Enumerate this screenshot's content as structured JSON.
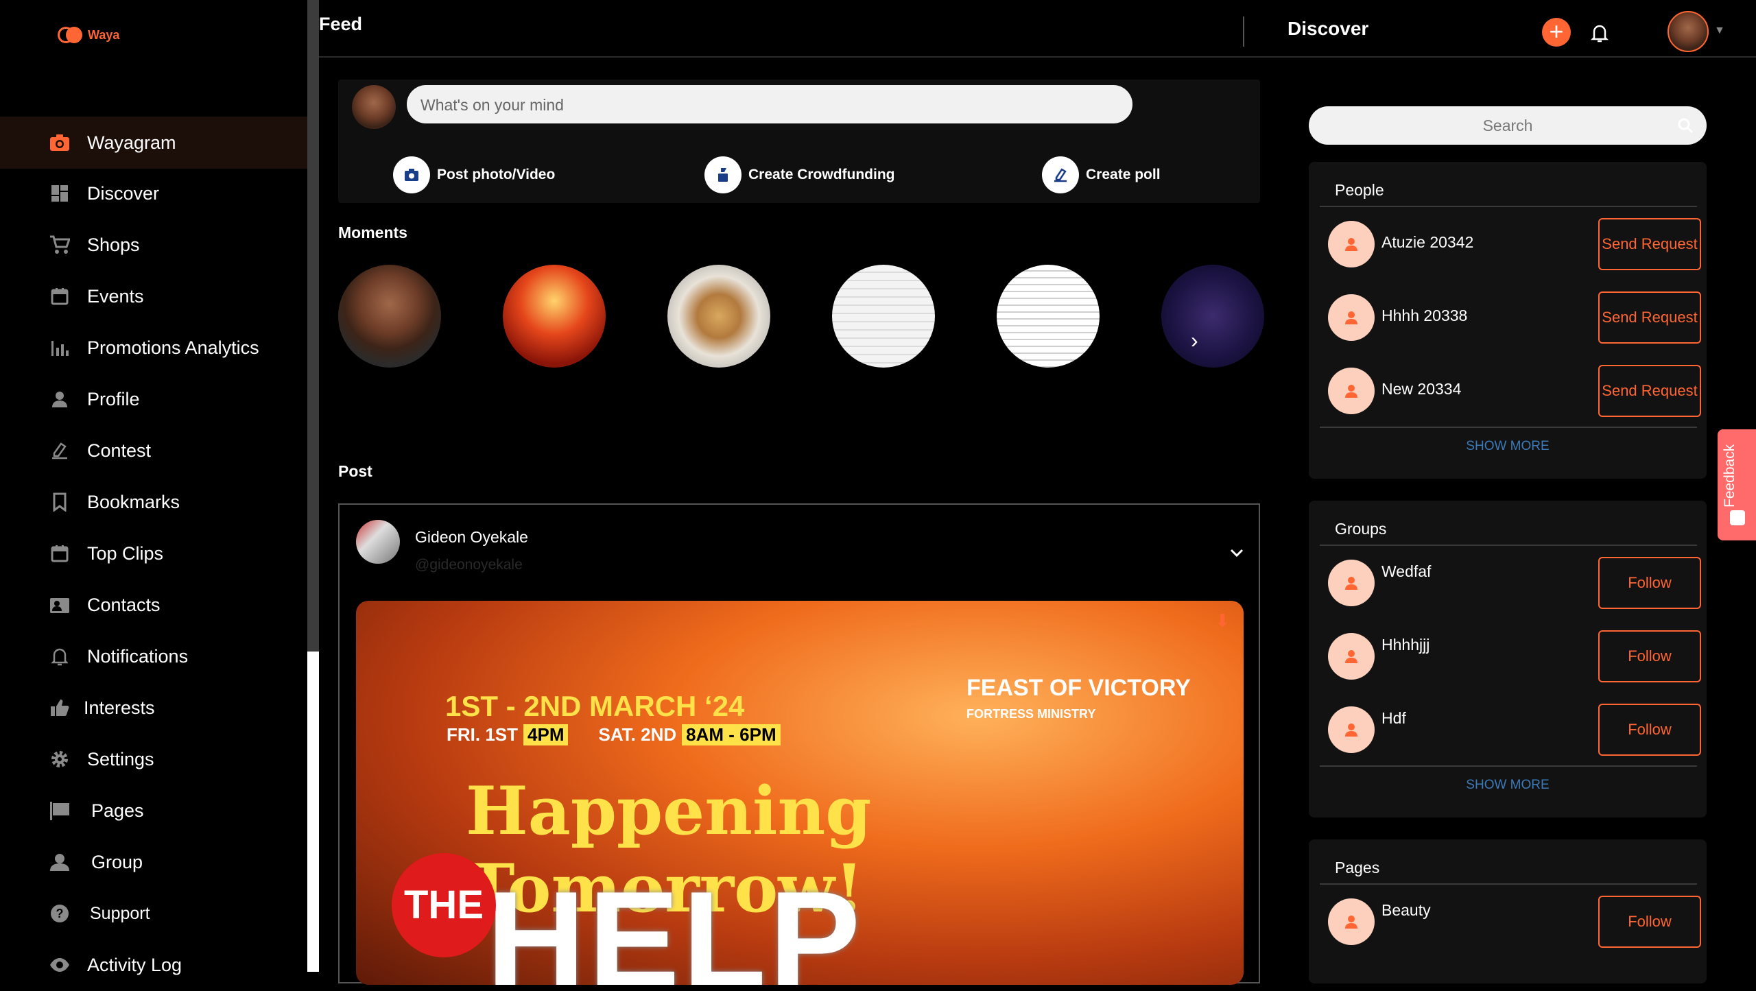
{
  "app": {
    "logo_text": "Waya"
  },
  "sidebar": {
    "items": [
      {
        "label": "Wayagram",
        "icon": "camera-icon",
        "active": true
      },
      {
        "label": "Discover",
        "icon": "dashboard-icon"
      },
      {
        "label": "Shops",
        "icon": "cart-icon"
      },
      {
        "label": "Events",
        "icon": "calendar-icon"
      },
      {
        "label": "Promotions Analytics",
        "icon": "bar-chart-icon"
      },
      {
        "label": "Profile",
        "icon": "person-icon"
      },
      {
        "label": "Contest",
        "icon": "vote-icon"
      },
      {
        "label": "Bookmarks",
        "icon": "bookmark-icon"
      },
      {
        "label": "Top Clips",
        "icon": "calendar-icon"
      },
      {
        "label": "Contacts",
        "icon": "contacts-icon"
      },
      {
        "label": "Notifications",
        "icon": "bell-icon"
      },
      {
        "label": "Interests",
        "icon": "thumbs-up-icon"
      },
      {
        "label": "Settings",
        "icon": "gear-icon"
      },
      {
        "label": "Pages",
        "icon": "flag-icon"
      },
      {
        "label": "Group",
        "icon": "group-icon"
      },
      {
        "label": "Support",
        "icon": "help-icon"
      },
      {
        "label": "Activity Log",
        "icon": "eye-icon"
      }
    ]
  },
  "topbar": {
    "feed_title": "Feed",
    "discover_title": "Discover"
  },
  "composer": {
    "placeholder": "What's on your mind",
    "actions": [
      {
        "label": "Post photo/Video",
        "icon": "camera-icon"
      },
      {
        "label": "Create Crowdfunding",
        "icon": "crowdfunding-icon"
      },
      {
        "label": "Create poll",
        "icon": "poll-icon"
      }
    ]
  },
  "moments": {
    "title": "Moments"
  },
  "post": {
    "section_title": "Post",
    "author_name": "Gideon Oyekale",
    "author_handle": "@gideonoyekale",
    "image": {
      "dates_line": "1ST - 2ND MARCH ‘24",
      "day1": "FRI. 1ST",
      "time1": "4PM",
      "day2": "SAT. 2ND",
      "time2": "8AM - 6PM",
      "feast": "FEAST OF VICTORY",
      "ministry": "FORTRESS MINISTRY",
      "headline": "Happening Tomorrow!",
      "the": "THE",
      "help": "HELP"
    }
  },
  "search": {
    "placeholder": "Search"
  },
  "people": {
    "title": "People",
    "items": [
      {
        "name": "Atuzie 20342",
        "action": "Send Request"
      },
      {
        "name": "Hhhh 20338",
        "action": "Send Request"
      },
      {
        "name": "New 20334",
        "action": "Send Request"
      }
    ],
    "show_more": "SHOW MORE"
  },
  "groups": {
    "title": "Groups",
    "items": [
      {
        "name": "Wedfaf",
        "action": "Follow"
      },
      {
        "name": "Hhhhjjj",
        "action": "Follow"
      },
      {
        "name": "Hdf",
        "action": "Follow"
      }
    ],
    "show_more": "SHOW MORE"
  },
  "pages": {
    "title": "Pages",
    "items": [
      {
        "name": "Beauty",
        "action": "Follow"
      }
    ]
  },
  "feedback": {
    "label": "Feedback"
  },
  "colors": {
    "accent": "#ff6634",
    "link": "#3d7ab8",
    "panel": "#121212"
  }
}
